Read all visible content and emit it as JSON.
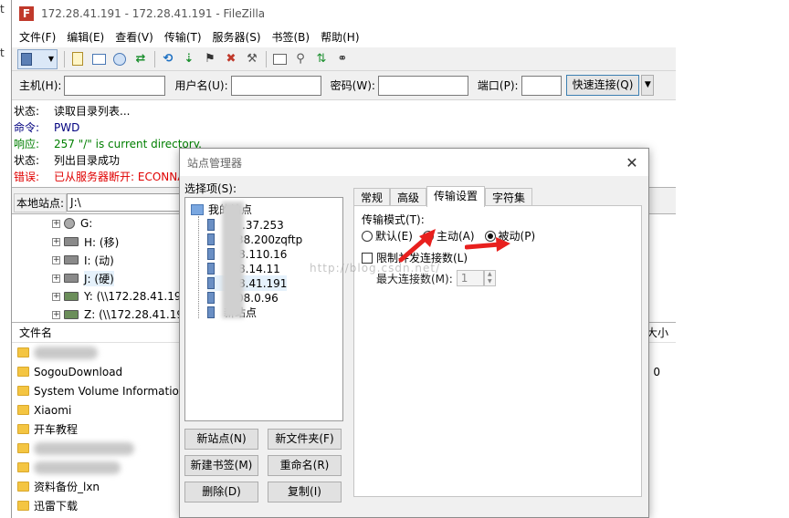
{
  "window": {
    "title": "172.28.41.191 - 172.28.41.191 - FileZilla",
    "app_icon_letter": "F"
  },
  "menu": [
    "文件(F)",
    "编辑(E)",
    "查看(V)",
    "传输(T)",
    "服务器(S)",
    "书签(B)",
    "帮助(H)"
  ],
  "quickconnect": {
    "host_label": "主机(H):",
    "user_label": "用户名(U):",
    "pass_label": "密码(W):",
    "port_label": "端口(P):",
    "connect_button": "快速连接(Q)"
  },
  "log": [
    {
      "label": "状态:",
      "text": "读取目录列表...",
      "kind": "status"
    },
    {
      "label": "命令:",
      "text": "PWD",
      "kind": "cmd"
    },
    {
      "label": "响应:",
      "text": "257 \"/\" is current directory.",
      "kind": "resp"
    },
    {
      "label": "状态:",
      "text": "列出目录成功",
      "kind": "status"
    },
    {
      "label": "错误:",
      "text": "已从服务器断开: ECONNA",
      "kind": "err"
    }
  ],
  "local": {
    "label": "本地站点:",
    "path": "J:\\"
  },
  "drives": [
    "G:",
    "H: (移)",
    "I: (动)",
    "J: (硬)",
    "Y: (\\\\172.28.41.19",
    "Z: (\\\\172.28.41.19"
  ],
  "file_list": {
    "col_name": "文件名",
    "col_size": "大小",
    "rows": [
      {
        "name": "",
        "size": ""
      },
      {
        "name": "SogouDownload",
        "size": "0"
      },
      {
        "name": "System Volume Information",
        "size": ""
      },
      {
        "name": "Xiaomi",
        "size": ""
      },
      {
        "name": "开车教程",
        "size": ""
      },
      {
        "name": "",
        "size": ""
      },
      {
        "name": "",
        "size": ""
      },
      {
        "name": "资料备份_lxn",
        "size": ""
      },
      {
        "name": "迅雷下载",
        "size": ""
      }
    ]
  },
  "side_letters": [
    "t",
    "t"
  ],
  "site_manager": {
    "title": "站点管理器",
    "select_label": "选择项(S):",
    "root": "我的站点",
    "sites": [
      ".37.253",
      "38.200zqftp",
      "8.110.16",
      "8.14.11",
      "8.41.191",
      "08.0.96",
      "新站点"
    ],
    "buttons": {
      "new_site": "新站点(N)",
      "new_folder": "新文件夹(F)",
      "new_bookmark": "新建书签(M)",
      "rename": "重命名(R)",
      "delete": "删除(D)",
      "copy": "复制(I)"
    },
    "tabs": [
      "常规",
      "高级",
      "传输设置",
      "字符集"
    ],
    "active_tab": 2,
    "transfer": {
      "mode_label": "传输模式(T):",
      "modes": [
        "默认(E)",
        "主动(A)",
        "被动(P)"
      ],
      "selected_mode": 2,
      "limit_label": "限制并发连接数(L)",
      "limit_checked": false,
      "max_conn_label": "最大连接数(M):",
      "max_conn_value": "1"
    },
    "watermark": "http://blog.csdn.net/"
  },
  "colors": {
    "accent_arrow": "#e8201e",
    "log_cmd": "#00007f",
    "log_resp": "#007f00",
    "log_err": "#e00000"
  }
}
